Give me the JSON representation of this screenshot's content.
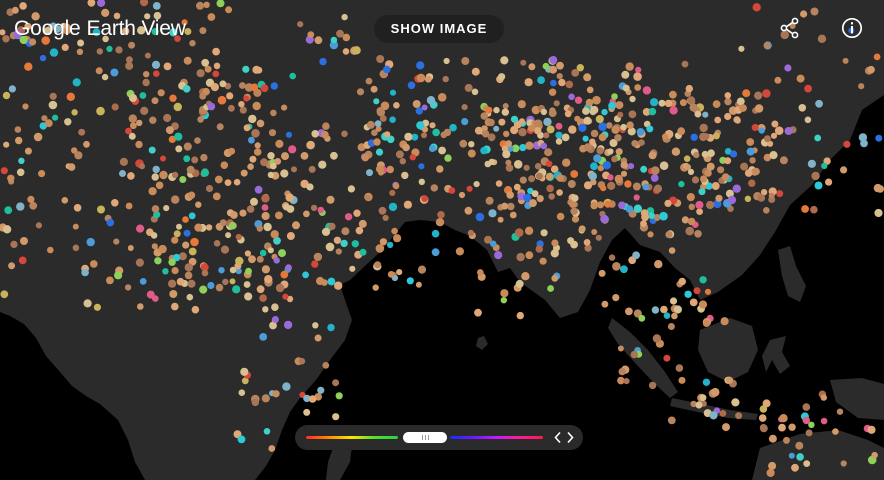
{
  "app": {
    "brand": "Google",
    "product": "Earth View",
    "show_image_label": "SHOW IMAGE"
  },
  "icons": {
    "share": "share-icon",
    "info": "info-icon",
    "arrows": "chevron-left-right-icon"
  },
  "colors": {
    "background": "#000000",
    "land": "#2b2b2b",
    "button_bg": "#202020",
    "text": "#ffffff"
  },
  "palette": {
    "left_gradient": [
      "#ff2a2a",
      "#ff8c00",
      "#ffe600",
      "#52e02a",
      "#27d04a"
    ],
    "right_gradient": [
      "#1a2cff",
      "#6a1aff",
      "#c21aff",
      "#ff1a9a",
      "#ff1a4a"
    ]
  }
}
